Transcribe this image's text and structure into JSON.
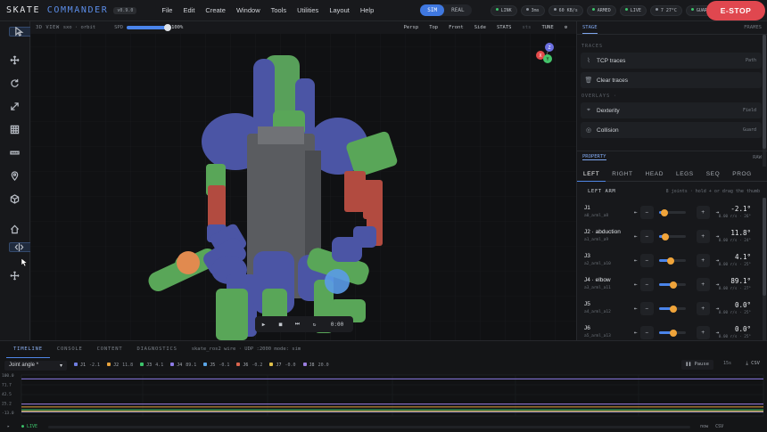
{
  "app": {
    "brand_a": "SKATE",
    "brand_b": "COMMANDER",
    "version": "v0.9.0"
  },
  "menu": [
    "File",
    "Edit",
    "Create",
    "Window",
    "Tools",
    "Utilities",
    "Layout",
    "Help"
  ],
  "mode_toggle": {
    "options": [
      "SIM",
      "REAL"
    ],
    "selected": "SIM"
  },
  "status_chips": [
    {
      "label": "LINK",
      "color": "#3cc46b"
    },
    {
      "label": "3ms",
      "color": "#8a9099"
    },
    {
      "label": "60 KB/s",
      "color": "#8a9099"
    },
    {
      "label": "ARMED",
      "color": "#3cc46b"
    },
    {
      "label": "LIVE",
      "color": "#3cc46b"
    },
    {
      "label": "7 27°C",
      "color": "#8a9099"
    },
    {
      "label": "GUARD",
      "color": "#3cc46b"
    }
  ],
  "help": "?",
  "estop": "E-STOP",
  "tools": [
    "select-icon",
    "move-icon",
    "rotate-icon",
    "scale-icon",
    "grid-icon",
    "ruler-icon",
    "pin-icon",
    "cube-icon",
    "home-icon",
    "mirror-icon",
    "drag-icon"
  ],
  "viewport": {
    "label": "3D VIEW",
    "sub": "sxo · orbit",
    "fps_label": "SPD",
    "fps_value": "100%",
    "fps_level": 1.0,
    "views": [
      "Persp",
      "Top",
      "Front",
      "Side",
      "STATS",
      "sts",
      "TUNE"
    ],
    "time": "0:00",
    "gizmo": {
      "x": "X",
      "y": "Y",
      "z": "Z"
    }
  },
  "right_panel": {
    "tabs": [
      "STAGE",
      "FRAMES"
    ],
    "sections": {
      "traces": "TRACES",
      "overlays": "OVERLAYS ·"
    },
    "traces": [
      {
        "label": "TCP traces",
        "tag": "Path"
      },
      {
        "label": "Clear traces",
        "tag": ""
      }
    ],
    "overlays": [
      {
        "label": "Dexterity",
        "tag": "Field"
      },
      {
        "label": "Collision",
        "tag": "Guard"
      }
    ],
    "prop_tab": "PROPERTY",
    "prop_tab2": "RAW",
    "limb_tabs": [
      "LEFT",
      "RIGHT",
      "HEAD",
      "LEGS",
      "SEQ",
      "PROG"
    ],
    "limb_selected": "LEFT",
    "arm_title": "LEFT ARM",
    "arm_hint": "8 joints · hold + or drag the thumb",
    "joints": [
      {
        "name": "J1",
        "sub": "a0_arml_a8",
        "value": "-2.1°",
        "range": "0.00 r/s · 26°",
        "level": 0.2
      },
      {
        "name": "J2 · abduction",
        "sub": "a1_arml_a9",
        "value": "11.8°",
        "range": "0.00 r/s · 24°",
        "level": 0.25
      },
      {
        "name": "J3",
        "sub": "a2_arml_a10",
        "value": "4.1°",
        "range": "0.00 r/s · 25°",
        "level": 0.45
      },
      {
        "name": "J4 · elbow",
        "sub": "a3_arml_a11",
        "value": "89.1°",
        "range": "0.00 r/s · 27°",
        "level": 0.55
      },
      {
        "name": "J5",
        "sub": "a4_arml_a12",
        "value": "0.0°",
        "range": "0.00 r/s · 25°",
        "level": 0.55
      },
      {
        "name": "J6",
        "sub": "a5_arml_a13",
        "value": "0.0°",
        "range": "0.00 r/s · 25°",
        "level": 0.55
      }
    ]
  },
  "bottom": {
    "tabs": [
      "TIMELINE",
      "CONSOLE",
      "CONTENT",
      "DIAGNOSTICS"
    ],
    "active_tab": "TIMELINE",
    "info": "skate_ros2 wire · UDP :2000  mode: sim",
    "select": "Joint angle *",
    "legend": [
      {
        "name": "J1",
        "value": "-2.1",
        "color": "#6f7de0"
      },
      {
        "name": "J2",
        "value": "11.8",
        "color": "#e8a33d"
      },
      {
        "name": "J3",
        "value": "4.1",
        "color": "#3cc46b"
      },
      {
        "name": "J4",
        "value": "89.1",
        "color": "#8d7be6"
      },
      {
        "name": "J5",
        "value": "-0.1",
        "color": "#5aa6e8"
      },
      {
        "name": "J6",
        "value": "-0.2",
        "color": "#d9644e"
      },
      {
        "name": "J7",
        "value": "-0.0",
        "color": "#e0c04a"
      },
      {
        "name": "J8",
        "value": "20.0",
        "color": "#9b7ee0"
      }
    ],
    "pause": "Pause",
    "window": "15s",
    "csv": "CSV",
    "plot_y": [
      "100.0",
      "71.7",
      "42.5",
      "25.2",
      "-13.0"
    ],
    "status": {
      "live": "LIVE",
      "right_a": "now",
      "right_b": "CSV"
    }
  }
}
